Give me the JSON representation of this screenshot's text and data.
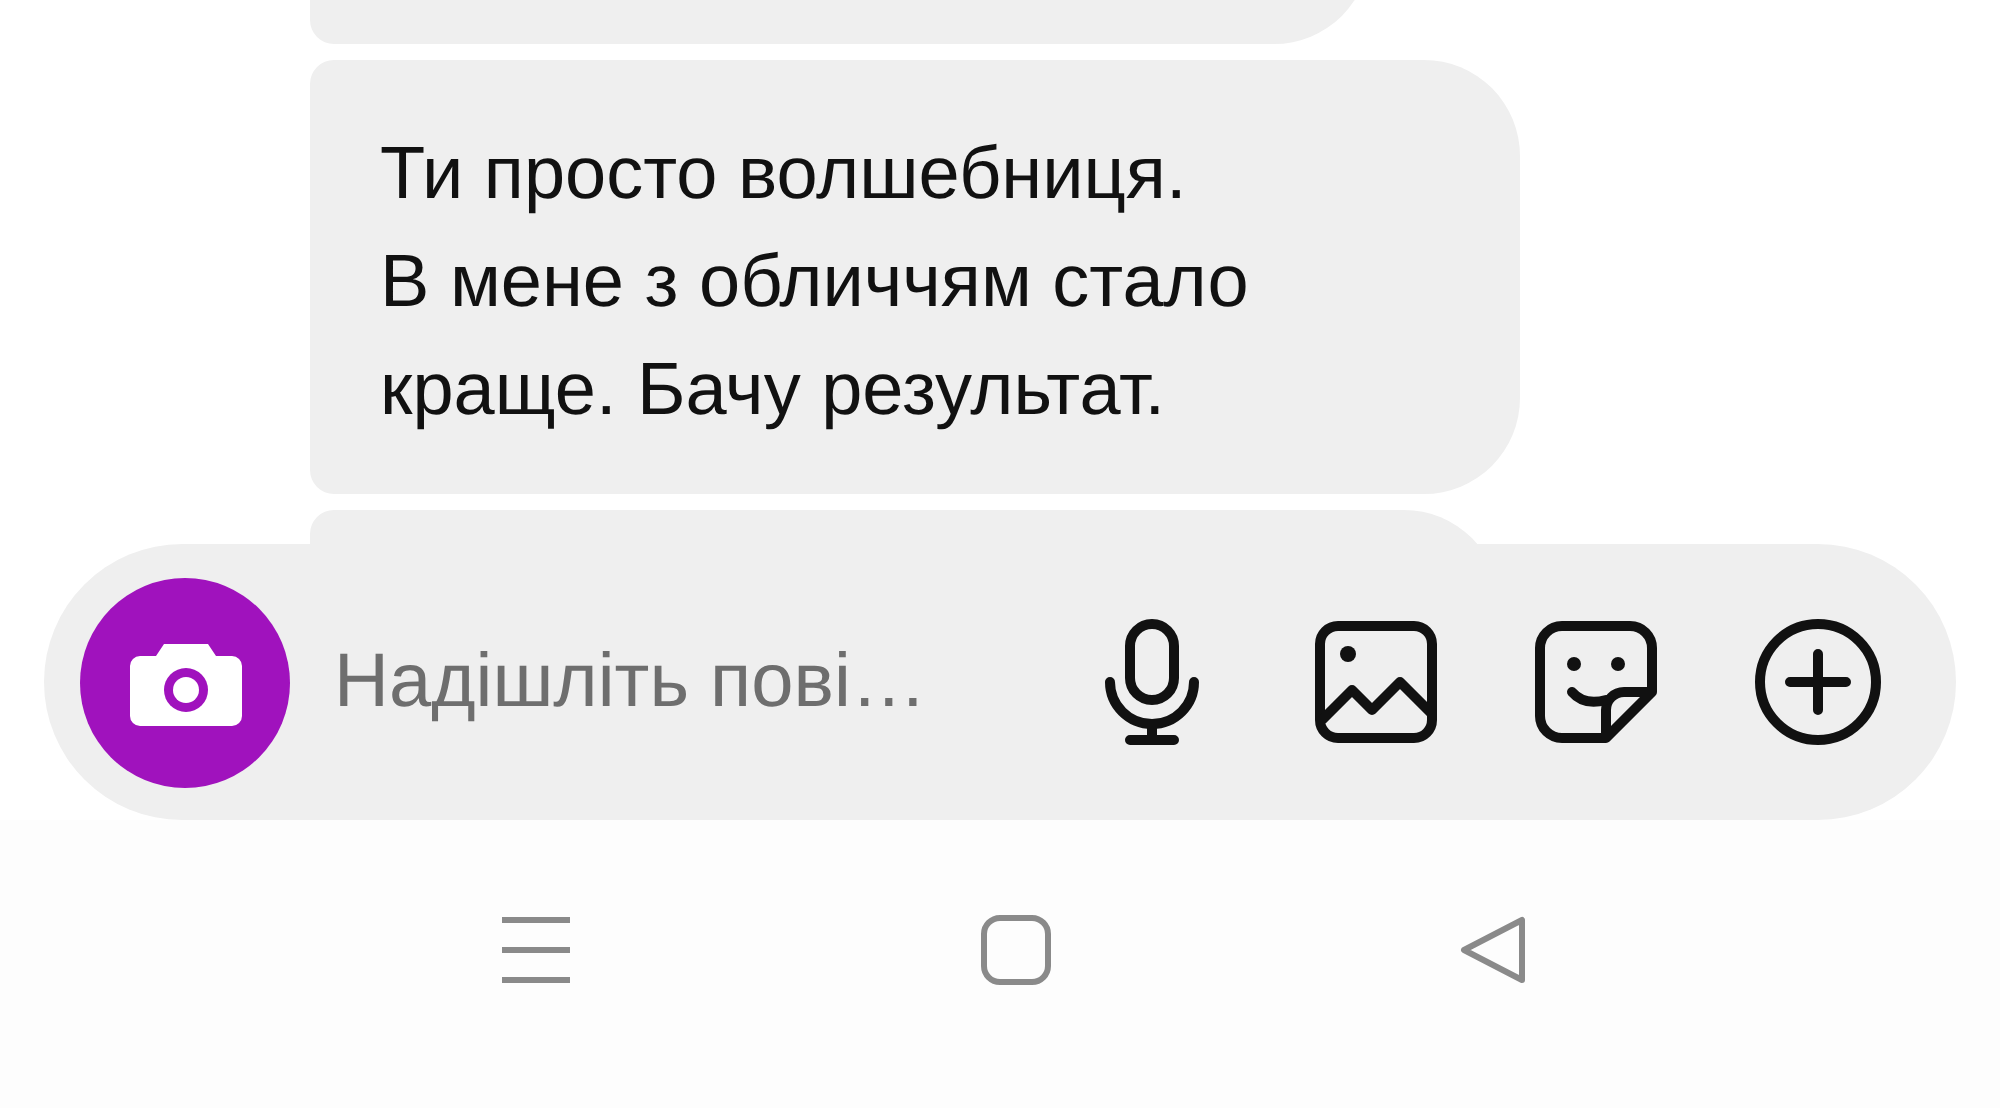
{
  "messages": [
    {
      "kind": "partial"
    },
    {
      "kind": "text",
      "text": "Ти просто волшебниця.\nВ мене з обличчям стало\nкраще. Бачу результат."
    },
    {
      "kind": "partial"
    }
  ],
  "composer": {
    "placeholder": "Надішліть пові…"
  }
}
